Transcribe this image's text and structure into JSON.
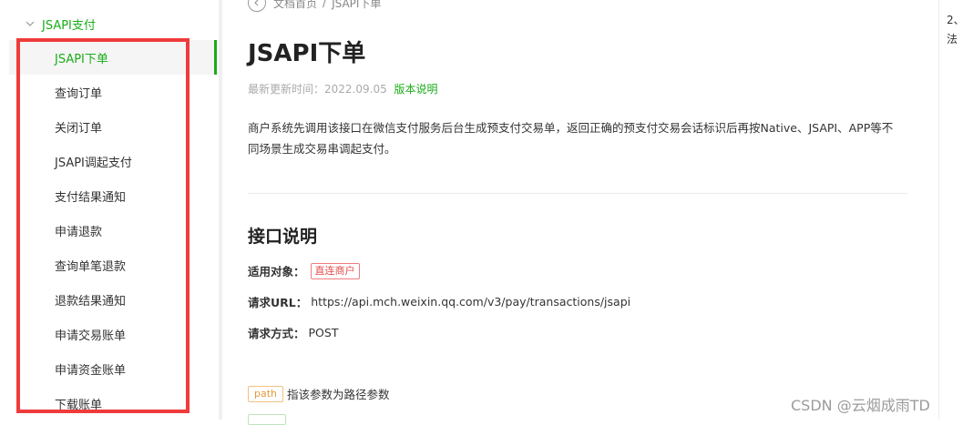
{
  "sidebar": {
    "group_label": "JSAPI支付",
    "items": [
      {
        "label": "JSAPI下单",
        "active": true
      },
      {
        "label": "查询订单"
      },
      {
        "label": "关闭订单"
      },
      {
        "label": "JSAPI调起支付"
      },
      {
        "label": "支付结果通知"
      },
      {
        "label": "申请退款"
      },
      {
        "label": "查询单笔退款"
      },
      {
        "label": "退款结果通知"
      },
      {
        "label": "申请交易账单"
      },
      {
        "label": "申请资金账单"
      },
      {
        "label": "下载账单"
      }
    ],
    "accent_color": "#1aad19",
    "highlight_frame_color": "#ef3b3b"
  },
  "breadcrumb": {
    "home": "文档首页",
    "sep": "/",
    "current": "JSAPI下单"
  },
  "page": {
    "title": "JSAPI下单",
    "updated_label": "最新更新时间：2022.09.05",
    "version_link": "版本说明",
    "description_line1": "商户系统先调用该接口在微信支付服务后台生成预支付交易单，返回正确的预支付交易会话标识后再按Native、JSAPI、APP等不",
    "description_line2": "同场景生成交易串调起支付。"
  },
  "interface": {
    "section_title": "接口说明",
    "target_label": "适用对象：",
    "target_tag": "直连商户",
    "url_label": "请求URL：",
    "url_value": "https://api.mch.weixin.qq.com/v3/pay/transactions/jsapi",
    "method_label": "请求方式：",
    "method_value": "POST",
    "path_tag": "path",
    "path_desc": "指该参数为路径参数"
  },
  "right_column": {
    "line1": "2、",
    "line2": "法"
  },
  "watermark": "CSDN @云烟成雨TD"
}
